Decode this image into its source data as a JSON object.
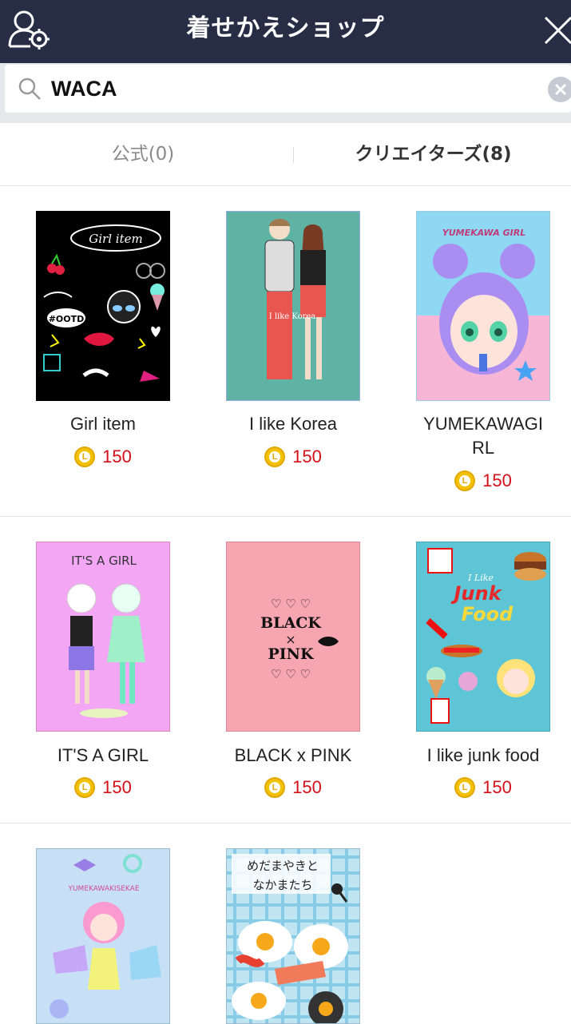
{
  "header": {
    "title": "着せかえショップ",
    "user_settings_icon": "user-gear-icon",
    "close_icon": "close-icon"
  },
  "search": {
    "value": "WACA",
    "search_icon": "search-icon",
    "clear_icon": "clear-icon"
  },
  "tabs": [
    {
      "label": "公式(0)",
      "active": false
    },
    {
      "label": "クリエイターズ(8)",
      "active": true
    }
  ],
  "items": [
    {
      "name": "Girl item",
      "price": "150",
      "bg": "#000000"
    },
    {
      "name": "I like Korea",
      "price": "150",
      "bg": "#5eb3a4"
    },
    {
      "name": "YUMEKAWAGI\nRL",
      "price": "150",
      "bg": "#f7b6d6"
    },
    {
      "name": "IT'S A GIRL",
      "price": "150",
      "bg": "#f2a6f4",
      "thumb_text": "IT'S A GIRL"
    },
    {
      "name": "BLACK x PINK",
      "price": "150",
      "bg": "#f6a5b1",
      "thumb_text": [
        "♡ ♡ ♡",
        "BLACK",
        "×",
        "PINK",
        "♡ ♡ ♡"
      ]
    },
    {
      "name": "I like junk food",
      "price": "150",
      "bg": "#5ec5d6"
    },
    {
      "name": "",
      "price": "",
      "bg": "#b9d8f2",
      "thumb_text": "YUMEKAWAKISEKAE"
    },
    {
      "name": "",
      "price": "",
      "bg": "#bfe4f2",
      "thumb_text": [
        "めだまやきと",
        "なかまたち"
      ]
    }
  ],
  "thumb_texts": {
    "girl_item": "Girl item",
    "girl_item_tag": "#OOTD",
    "korea": "I like Korea",
    "yumekawa": "YUMEKAWA GIRL",
    "junk_top": "I Like",
    "junk_mid": "Junk",
    "junk_bot": "Food"
  },
  "colors": {
    "header_bg": "#262d45",
    "price_red": "#d40f18",
    "coin_gold": "#f2c200"
  }
}
